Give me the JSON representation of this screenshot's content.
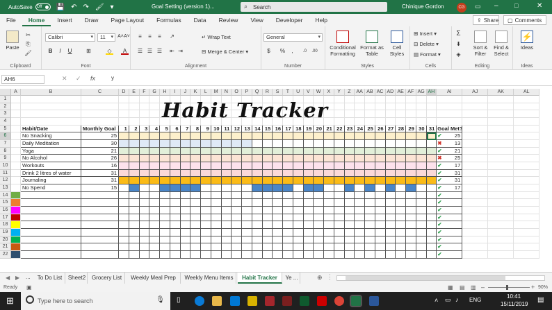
{
  "titlebar": {
    "autosave_label": "AutoSave",
    "autosave_state": "Off",
    "doc_title": "Goal Setting  (version 1)...",
    "search_placeholder": "Search",
    "user_name": "Chinique Gordon",
    "user_initials": "CG"
  },
  "menu": {
    "tabs": [
      "File",
      "Home",
      "Insert",
      "Draw",
      "Page Layout",
      "Formulas",
      "Data",
      "Review",
      "View",
      "Developer",
      "Help"
    ],
    "active": "Home",
    "share_label": "Share",
    "comments_label": "Comments"
  },
  "ribbon": {
    "clipboard": {
      "paste": "Paste",
      "label": "Clipboard"
    },
    "font": {
      "name": "Calibri",
      "size": "11",
      "label": "Font"
    },
    "alignment": {
      "wrap_text": "Wrap Text",
      "merge_center": "Merge & Center",
      "label": "Alignment"
    },
    "number": {
      "format": "General",
      "label": "Number"
    },
    "styles": {
      "conditional": "Conditional Formatting",
      "format_table": "Format as Table",
      "cell_styles": "Cell Styles",
      "label": "Styles"
    },
    "cells": {
      "insert": "Insert",
      "delete": "Delete",
      "format": "Format",
      "label": "Cells"
    },
    "editing": {
      "sort_filter": "Sort & Filter",
      "find_select": "Find & Select",
      "label": "Editing"
    },
    "ideas": {
      "ideas": "Ideas",
      "label": "Ideas"
    }
  },
  "formula_bar": {
    "name_box": "AH6",
    "fx": "fx",
    "value": "y"
  },
  "sheet": {
    "title": "Habit Tracker",
    "columns": [
      "A",
      "B",
      "C",
      "D",
      "E",
      "F",
      "G",
      "H",
      "I",
      "J",
      "K",
      "L",
      "M",
      "N",
      "O",
      "P",
      "Q",
      "R",
      "S",
      "T",
      "U",
      "V",
      "W",
      "X",
      "Y",
      "Z",
      "AA",
      "AB",
      "AC",
      "AD",
      "AE",
      "AF",
      "AG",
      "AH",
      "AI",
      "AJ",
      "AK",
      "AL"
    ],
    "header_habit": "Habit/Date",
    "header_goal": "Monthly Goal",
    "header_met": "Goal Met?",
    "days": [
      "1",
      "2",
      "3",
      "4",
      "5",
      "6",
      "7",
      "8",
      "9",
      "10",
      "11",
      "12",
      "13",
      "14",
      "15",
      "16",
      "17",
      "18",
      "19",
      "20",
      "21",
      "22",
      "23",
      "24",
      "25",
      "26",
      "27",
      "28",
      "29",
      "30",
      "31"
    ],
    "habits": [
      {
        "name": "No Snacking",
        "goal": "25",
        "met": "25",
        "status": "check",
        "color": "#fdf0cc"
      },
      {
        "name": "Daily Meditation",
        "goal": "30",
        "met": "13",
        "status": "cross",
        "color": "#dfe9f6"
      },
      {
        "name": "Yoga",
        "goal": "21",
        "met": "21",
        "status": "check",
        "color": "#e2efd9"
      },
      {
        "name": "No Alcohol",
        "goal": "26",
        "met": "25",
        "status": "cross",
        "color": "#fbe4d5"
      },
      {
        "name": "Workouts",
        "goal": "16",
        "met": "17",
        "status": "check",
        "color": "#fde2ec"
      },
      {
        "name": "Drink 2 litres of water",
        "goal": "31",
        "met": "31",
        "status": "check",
        "color": "#fbd9d9"
      },
      {
        "name": "Journaling",
        "goal": "31",
        "met": "31",
        "status": "check",
        "color": "#fbbb17"
      },
      {
        "name": "No Spend",
        "goal": "15",
        "met": "17",
        "status": "check",
        "color": "#4a86c8"
      }
    ],
    "swatches": [
      "#70ad47",
      "#ed7d31",
      "#ff00ff",
      "#c00000",
      "#ffff00",
      "#00b0f0",
      "#00b050",
      "#c55a11",
      "#2f4f6f"
    ]
  },
  "sheet_tabs": {
    "items": [
      "To Do List",
      "Sheet2",
      "Grocery List",
      "Weekly Meal Prep",
      "Weekly Menu Items",
      "Habit Tracker",
      "Ye ..."
    ],
    "active": "Habit Tracker"
  },
  "status": {
    "ready": "Ready",
    "zoom": "90%"
  },
  "taskbar": {
    "search_placeholder": "Type here to search",
    "lang": "ENG",
    "time": "10:41",
    "date": "15/11/2019"
  }
}
